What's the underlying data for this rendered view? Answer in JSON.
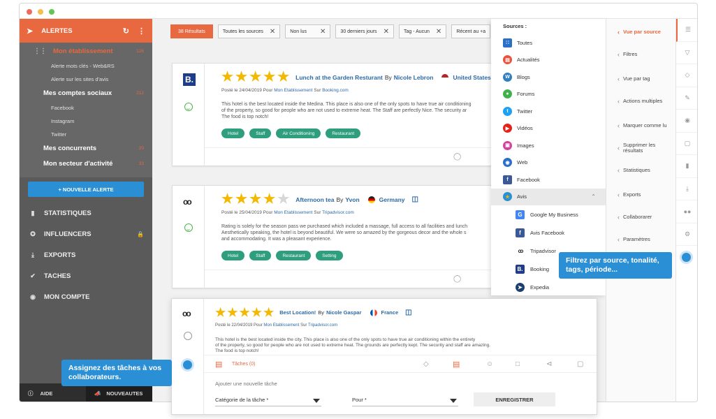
{
  "sidebar": {
    "header": "ALERTES",
    "tree": {
      "my_establishment": {
        "label": "Mon établissement",
        "count": "126"
      },
      "subs1": [
        "Alerte mots clés - Web&RS",
        "Alerte sur les sites d'avis"
      ],
      "social": {
        "label": "Mes comptes sociaux",
        "count": "212"
      },
      "subs2": [
        "Facebook",
        "Instagram",
        "Twitter"
      ],
      "competitors": {
        "label": "Mes concurrents",
        "count": "20"
      },
      "sector": {
        "label": "Mon secteur d'activité",
        "count": "33"
      }
    },
    "new_alert": "+ NOUVELLE ALERTE",
    "nav": [
      "STATISTIQUES",
      "INFLUENCERS",
      "EXPORTS",
      "TACHES",
      "MON COMPTE"
    ],
    "footer": {
      "help": "AIDE",
      "news": "NOUVEAUTES"
    }
  },
  "filters": {
    "results": "38 Résultats",
    "chips": [
      "Toutes les sources",
      "Non lus",
      "30 derniers jours",
      "Tag - Aucun",
      "Récent au +a"
    ]
  },
  "cards": [
    {
      "title": "Lunch at the Garden Resturant",
      "by": "By",
      "author": "Nicole Lebron",
      "country": "United States",
      "meta": "Posté le 24/04/2019 Pour",
      "establishment": "Mon Etablissement",
      "sur": "Sur",
      "source": "Booking.com",
      "text": [
        "This hotel is the best located inside the Medina. This place is also one of the only spots to have true air conditioning",
        "of the property, so good for people who are not used to extreme heat. The Staff are perfectly Nice. The security ar",
        "The food is top notch!"
      ],
      "tags": [
        "Hotel",
        "Staff",
        "Air Conditioning",
        "Restaurant"
      ],
      "rating": 4.5
    },
    {
      "title": "Afternoon tea",
      "by": "By",
      "author": "Yvon",
      "country": "Germany",
      "meta": "Posté le 25/04/2019 Pour",
      "establishment": "Mon Etablissement",
      "sur": "Sur",
      "source": "Tripadvisor.com",
      "text": [
        "Rating is solely for the season pass we purchased which included a massage, full access to all facilities and lunch",
        "Aesthetically speaking, the hotel is beyond beautiful. We were so amazed by the gorgeous decor and the whole s",
        "and accommodating. It was a pleasant experience."
      ],
      "tags": [
        "Hotel",
        "Staff",
        "Restaurant",
        "Setting"
      ],
      "rating": 4
    }
  ],
  "big_card": {
    "title": "Best Location!",
    "by": "By",
    "author": "Nicole Gaspar",
    "country": "France",
    "meta": "Posté le 22/04/2019 Pour",
    "establishment": "Mon Etablissement",
    "sur": "Sur",
    "source": "Tripadvisor.com",
    "text": [
      "This hotel is the best located inside the city. This place is also one of the only spots to have true air conditioning within the entirety",
      "of the property, so good for people who are not used to extreme heat. The grounds are perfectly kept. The security and staff are amazing.",
      "The food is top notch!"
    ],
    "tasks": "Tâches (0)",
    "add_task": "Ajouter une nouvelle tâche",
    "category": "Catégorie de la tâche *",
    "for": "Pour *",
    "save": "ENREGISTRER",
    "rating": 4.5
  },
  "sources": {
    "title": "Sources :",
    "items": [
      "Toutes",
      "Actualités",
      "Blogs",
      "Forums",
      "Twitter",
      "Vidéos",
      "Images",
      "Web",
      "Facebook",
      "Avis"
    ],
    "avis_subs": [
      "Google My Business",
      "Avis Facebook",
      "Tripadvisor",
      "Booking",
      "Expedia"
    ]
  },
  "right_menu": [
    "Vue par source",
    "Filtres",
    "Vue par tag",
    "Actions multiples",
    "Marquer comme lu",
    "Supprimer les résultats",
    "Statistiques",
    "Exports",
    "Collaborarer",
    "Paramètres"
  ],
  "tooltips": {
    "filter": "Filtrez par source, tonalité, tags, période...",
    "assign": "Assignez des tâches à vos collaborateurs."
  },
  "colors": {
    "accent": "#e8683f",
    "blue": "#2b8fd6",
    "tag": "#2f9e7e",
    "star": "#f5b800"
  }
}
